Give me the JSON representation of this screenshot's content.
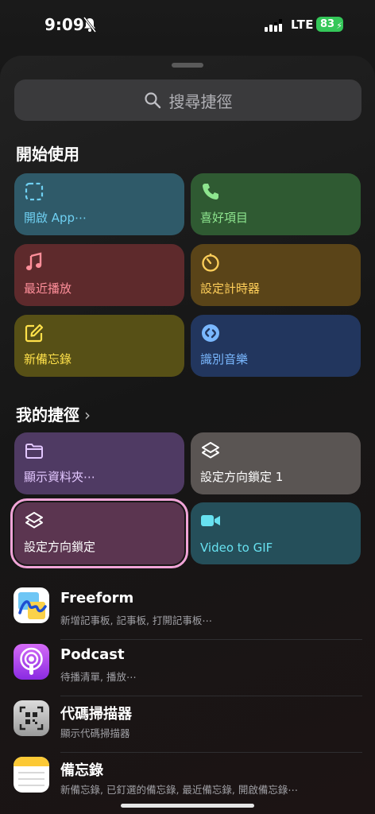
{
  "status_bar": {
    "time": "9:09",
    "network": "LTE",
    "battery": "83"
  },
  "search": {
    "placeholder": "搜尋捷徑"
  },
  "sections": {
    "get_started": "開始使用",
    "my_shortcuts": "我的捷徑",
    "my_shortcuts_chevron": "›"
  },
  "get_started_tiles": [
    {
      "label": "開啟 App⋯",
      "icon": "dashed-square-icon",
      "bg": "#2f5a69",
      "fg": "#6fd0f2"
    },
    {
      "label": "喜好項目",
      "icon": "phone-icon",
      "bg": "#2f5a32",
      "fg": "#8ee58f"
    },
    {
      "label": "最近播放",
      "icon": "music-note-icon",
      "bg": "#5e2a2c",
      "fg": "#ff8f9a"
    },
    {
      "label": "設定計時器",
      "icon": "timer-icon",
      "bg": "#5a4418",
      "fg": "#ffcf5a"
    },
    {
      "label": "新備忘錄",
      "icon": "compose-icon",
      "bg": "#575016",
      "fg": "#ffe14a"
    },
    {
      "label": "識別音樂",
      "icon": "shazam-icon",
      "bg": "#22365e",
      "fg": "#7ab8ff"
    }
  ],
  "my_shortcut_tiles": [
    {
      "label": "顯示資料夾⋯",
      "icon": "folder-icon",
      "bg": "#4f3a63",
      "fg": "#e3c7ff"
    },
    {
      "label": "設定方向鎖定 1",
      "icon": "layers-icon",
      "bg": "#5a5553",
      "fg": "#ffffff"
    },
    {
      "label": "設定方向鎖定",
      "icon": "layers-icon",
      "bg": "#5b3550",
      "fg": "#ffffff",
      "selected": true
    },
    {
      "label": "Video to GIF",
      "icon": "video-camera-icon",
      "bg": "#254f5a",
      "fg": "#67e1f0"
    }
  ],
  "apps": [
    {
      "name": "Freeform",
      "sub": "新增記事板, 記事板, 打開記事板⋯",
      "icon": "freeform-icon"
    },
    {
      "name": "Podcast",
      "sub": "待播清單, 播放⋯",
      "icon": "podcasts-icon"
    },
    {
      "name": "代碼掃描器",
      "sub": "顯示代碼掃描器",
      "icon": "code-scanner-icon"
    },
    {
      "name": "備忘錄",
      "sub": "新備忘錄, 已釘選的備忘錄, 最近備忘錄, 開啟備忘錄⋯",
      "icon": "notes-icon"
    }
  ]
}
